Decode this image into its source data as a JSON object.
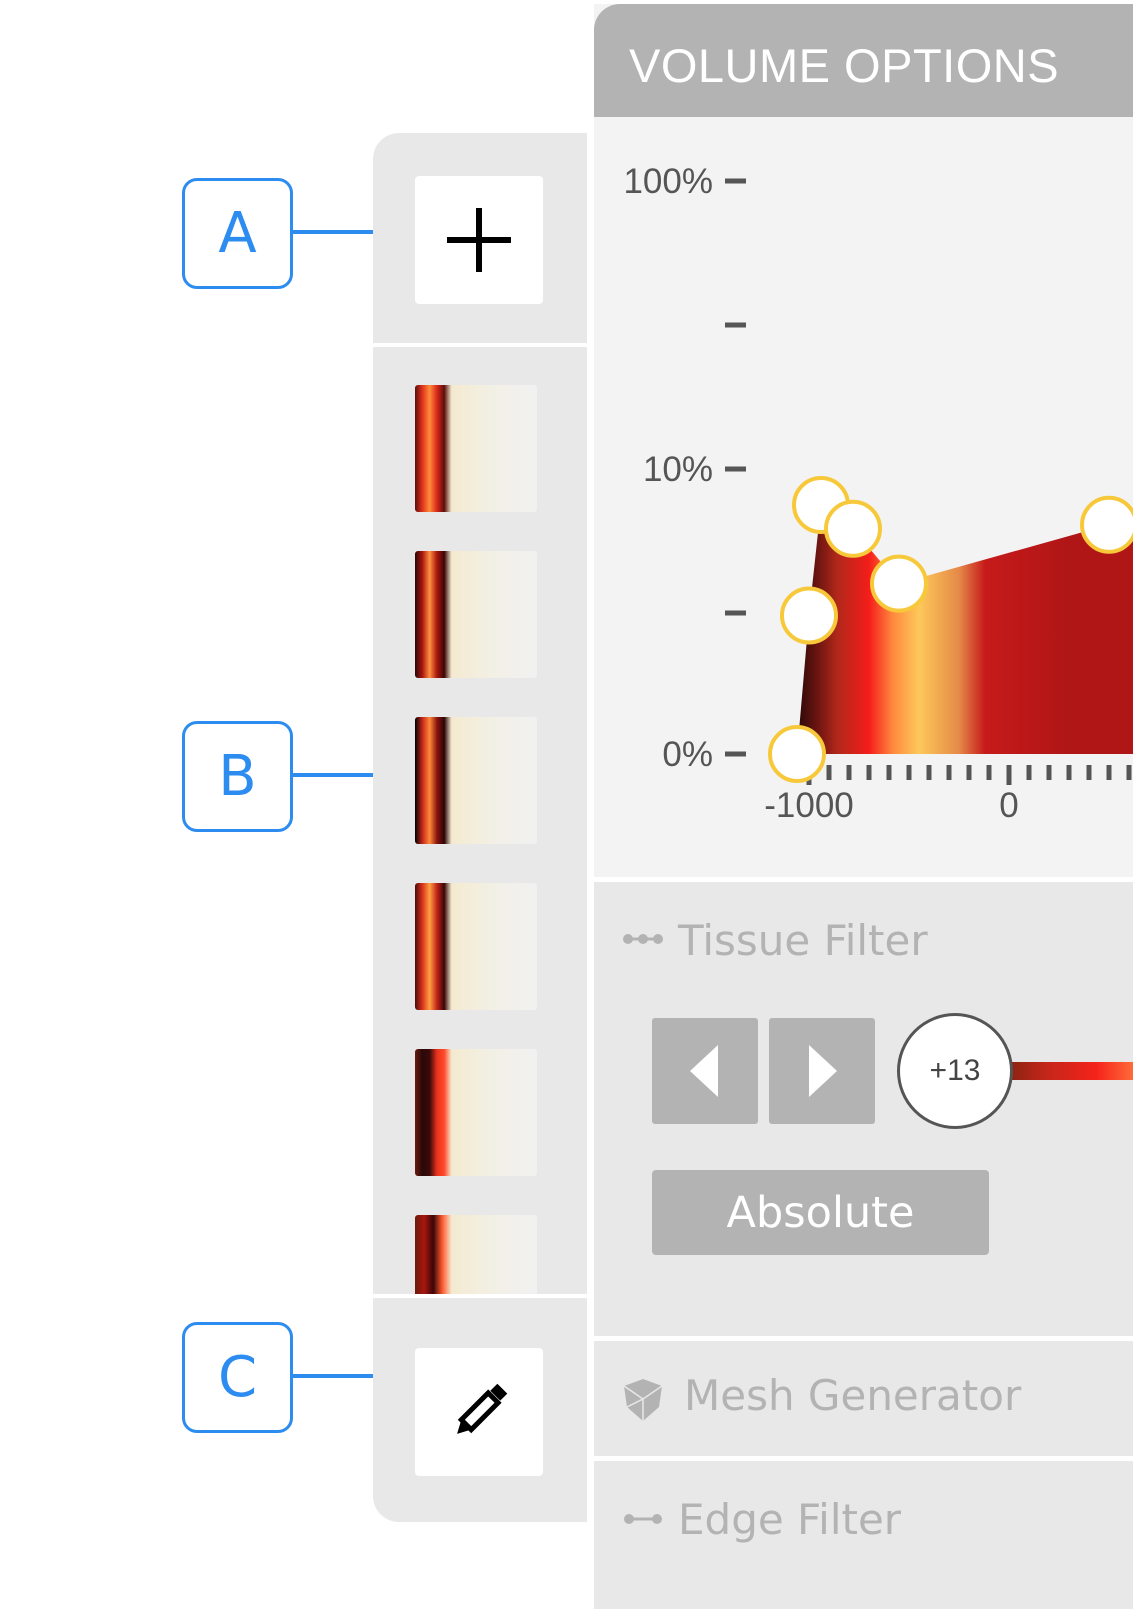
{
  "callouts": [
    {
      "letter": "A",
      "target": "add-colormap-button"
    },
    {
      "letter": "B",
      "target": "colormap-swatch-list"
    },
    {
      "letter": "C",
      "target": "edit-colormap-button"
    }
  ],
  "palette": {
    "add_icon": "plus-icon",
    "edit_icon": "pencil-icon",
    "swatches": [
      {
        "name": "swatch-1",
        "stops": [
          "#5a0f0a",
          "#e0311c",
          "#ff8c3a",
          "#d9281a",
          "#5a0f0a",
          "#f4ead0",
          "#f2f0e6",
          "#f1f1f1"
        ]
      },
      {
        "name": "swatch-2",
        "stops": [
          "#2a0606",
          "#a8160e",
          "#ff9040",
          "#a8160e",
          "#3a0606",
          "#f4ead0",
          "#f2f0e6",
          "#f1f1f1"
        ]
      },
      {
        "name": "swatch-3",
        "stops": [
          "#000000",
          "#c4261a",
          "#ff8a38",
          "#8a1410",
          "#2a0404",
          "#f4ead0",
          "#f2f0e6",
          "#f1f1f1"
        ]
      },
      {
        "name": "swatch-4",
        "stops": [
          "#4a0c08",
          "#d8301c",
          "#ffa040",
          "#c0241a",
          "#3a0606",
          "#f4ead0",
          "#f2f0e6",
          "#f1f1f1"
        ]
      },
      {
        "name": "swatch-5",
        "stops": [
          "#6a1a0e",
          "#2a0808",
          "#3a0a0a",
          "#e8321c",
          "#ff4a2a",
          "#f4ead0",
          "#f2f0e6",
          "#f1f1f1"
        ]
      },
      {
        "name": "swatch-6",
        "stops": [
          "#6a1a0e",
          "#a8160e",
          "#3a0606",
          "#ff5a30",
          "#f4ead0",
          "#f2f0e6",
          "#f1f1f1"
        ]
      }
    ]
  },
  "volume_options": {
    "title": "VOLUME OPTIONS",
    "sections": {
      "tissue_filter": {
        "title": "Tissue Filter",
        "icon": "three-dot-connector-icon",
        "prev_label": "previous-icon",
        "next_label": "next-icon",
        "slider_value": "+13",
        "mode_button": "Absolute"
      },
      "mesh_generator": {
        "title": "Mesh Generator",
        "icon": "mesh-cube-icon"
      },
      "edge_filter": {
        "title": "Edge Filter",
        "icon": "edge-connector-icon"
      }
    }
  },
  "chart_data": {
    "type": "area",
    "title": "",
    "xlabel": "",
    "ylabel": "",
    "y_scale": "log",
    "y_ticks": [
      {
        "label": "100%",
        "value": 100
      },
      {
        "label": "",
        "value": 31.6
      },
      {
        "label": "10%",
        "value": 10
      },
      {
        "label": "",
        "value": 3.16
      },
      {
        "label": "0%",
        "value": 0
      }
    ],
    "x_tick_labels": [
      {
        "label": "-1000",
        "value": -1000
      },
      {
        "label": "0",
        "value": 0
      }
    ],
    "x_minor_step": 100,
    "x_range": [
      -1100,
      600
    ],
    "control_points": [
      {
        "x": -1060,
        "y": 0.0
      },
      {
        "x": -1000,
        "y": 3.1
      },
      {
        "x": -940,
        "y": 7.5
      },
      {
        "x": -780,
        "y": 6.2
      },
      {
        "x": -550,
        "y": 4.0
      },
      {
        "x": 500,
        "y": 6.4
      }
    ],
    "gradient_stops": [
      {
        "x": -1060,
        "color": "#2a0808"
      },
      {
        "x": -960,
        "color": "#6a1410"
      },
      {
        "x": -860,
        "color": "#b0281a"
      },
      {
        "x": -700,
        "color": "#f51d1a"
      },
      {
        "x": -580,
        "color": "#ff8a3e"
      },
      {
        "x": -450,
        "color": "#fdc85a"
      },
      {
        "x": -250,
        "color": "#e58a48"
      },
      {
        "x": -120,
        "color": "#c61a1a"
      },
      {
        "x": 300,
        "color": "#b01616"
      }
    ],
    "point_stroke": "#f7c93a",
    "point_fill": "#ffffff"
  }
}
